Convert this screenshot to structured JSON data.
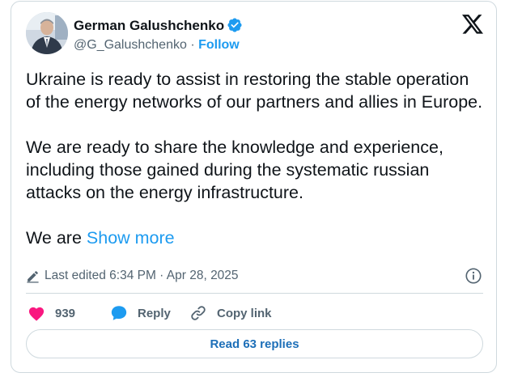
{
  "author": {
    "name": "German Galushchenko",
    "handle": "@G_Galushchenko",
    "separator": " · ",
    "follow_label": "Follow",
    "verified_color": "#1d9bf0"
  },
  "platform": {
    "logo_icon": "x-logo-icon"
  },
  "tweet": {
    "paragraphs": [
      "Ukraine is ready to assist in restoring the stable operation of the energy networks of our partners and allies in Europe.",
      "We are ready to share the knowledge and experience, including those gained during the systematic russian attacks on the energy infrastructure."
    ],
    "truncated_text": "We are ",
    "show_more_label": "Show more"
  },
  "meta": {
    "edited_label": "Last edited 6:34 PM · Apr 28, 2025",
    "edit_icon": "pencil-icon",
    "info_icon": "info-icon"
  },
  "actions": {
    "likes_count": "939",
    "like_color": "#f91880",
    "reply_label": "Reply",
    "reply_color": "#1d9bf0",
    "copy_link_label": "Copy link"
  },
  "replies": {
    "read_label": "Read 63 replies"
  }
}
